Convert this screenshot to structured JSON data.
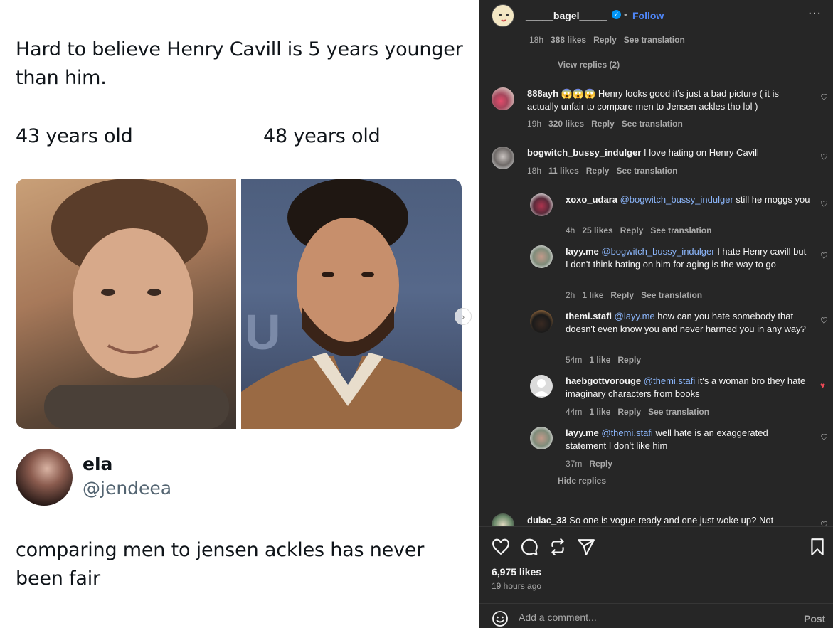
{
  "tweet": {
    "top_text": "Hard to believe Henry Cavill is 5 years younger than him.",
    "left_label": "43 years old",
    "right_label": "48 years old",
    "reply_name": "ela",
    "reply_handle": "@jendeea",
    "bottom_text": "comparing men to jensen ackles has never been fair"
  },
  "header": {
    "username": "_____bagel_____",
    "follow": "Follow",
    "more": "···"
  },
  "comments": {
    "c0_meta": [
      "18h",
      "388 likes",
      "Reply",
      "See translation"
    ],
    "view_replies": "View replies (2)",
    "c1": {
      "user": "888ayh",
      "emojis": "😱😱😱",
      "text": "Henry looks good it’s just a bad picture ( it is actually unfair to compare men to Jensen ackles tho lol )",
      "time": "19h",
      "likes": "320 likes",
      "reply": "Reply",
      "translate": "See translation"
    },
    "c2": {
      "user": "bogwitch_bussy_indulger",
      "text": "I love hating on Henry Cavill",
      "time": "18h",
      "likes": "11 likes",
      "reply": "Reply",
      "translate": "See translation"
    },
    "c3": {
      "user": "xoxo_udara",
      "mention": "@bogwitch_bussy_indulger",
      "text": "still he moggs you",
      "time": "4h",
      "likes": "25 likes",
      "reply": "Reply",
      "translate": "See translation"
    },
    "c4": {
      "user": "layy.me",
      "mention": "@bogwitch_bussy_indulger",
      "text": "I hate Henry cavill but I don't think hating on him for aging is the way to go",
      "time": "2h",
      "likes": "1 like",
      "reply": "Reply",
      "translate": "See translation"
    },
    "c5": {
      "user": "themi.stafi",
      "mention": "@layy.me",
      "text": "how can you hate somebody that doesn't even know you and never harmed you in any way?",
      "time": "54m",
      "likes": "1 like",
      "reply": "Reply"
    },
    "c6": {
      "user": "haebgottvorouge",
      "mention": "@themi.stafi",
      "text": "it's a woman bro they hate imaginary characters from books",
      "time": "44m",
      "likes": "1 like",
      "reply": "Reply",
      "translate": "See translation"
    },
    "c7": {
      "user": "layy.me",
      "mention": "@themi.stafi",
      "text": "well hate is an exaggerated statement I don't like him",
      "time": "37m",
      "reply": "Reply"
    },
    "hide_replies": "Hide replies",
    "c8": {
      "user": "dulac_33",
      "text": "So one is vogue ready and one just woke up? Not"
    }
  },
  "footer": {
    "likes": "6,975 likes",
    "posted": "19 hours ago",
    "placeholder": "Add a comment...",
    "post": "Post"
  },
  "colors": {
    "accent": "#4f86f7",
    "liked": "#ed4956",
    "panel_bg": "#262626"
  }
}
